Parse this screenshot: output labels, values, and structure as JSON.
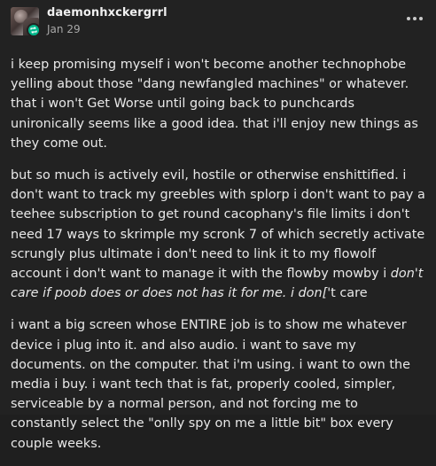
{
  "post": {
    "author": {
      "username": "daemonhxckergrrl",
      "avatar_icon": "avatar-image",
      "badge_icon": "reblog-icon",
      "badge_color": "#00b88c"
    },
    "date": "Jan 29",
    "menu_icon": "more-options-icon",
    "paragraphs": [
      {
        "text": "i keep promising myself i won't become another technophobe yelling about those \"dang newfangled machines\" or whatever. that i won't Get Worse until going back to punchcards unironically seems like a good idea. that i'll enjoy new things as they come out."
      },
      {
        "text": "but so much is actively evil, hostile or otherwise enshittified. i don't want to track my greebles with splorp i don't want to pay a teehee subscription to get round cacophany's file limits i don't need 17 ways to skrimple my scronk 7 of which secretly activate scrungly plus ultimate i don't need to link it to my flowolf account i don't want to manage it with the flowby mowby i ",
        "italic": "don't care if poob does or does not has it for me. i don[",
        "tail": "'t care"
      },
      {
        "text": "i want a big screen whose ENTIRE job is to show me whatever device i plug into it. and also audio. i want to save my documents. on the computer. that i'm using. i want to own the media i buy. i want tech that is fat, properly cooled, simpler, serviceable by a normal person, and not forcing me to constantly select the \"onlly spy on me a little bit\" box every couple weeks."
      }
    ]
  }
}
